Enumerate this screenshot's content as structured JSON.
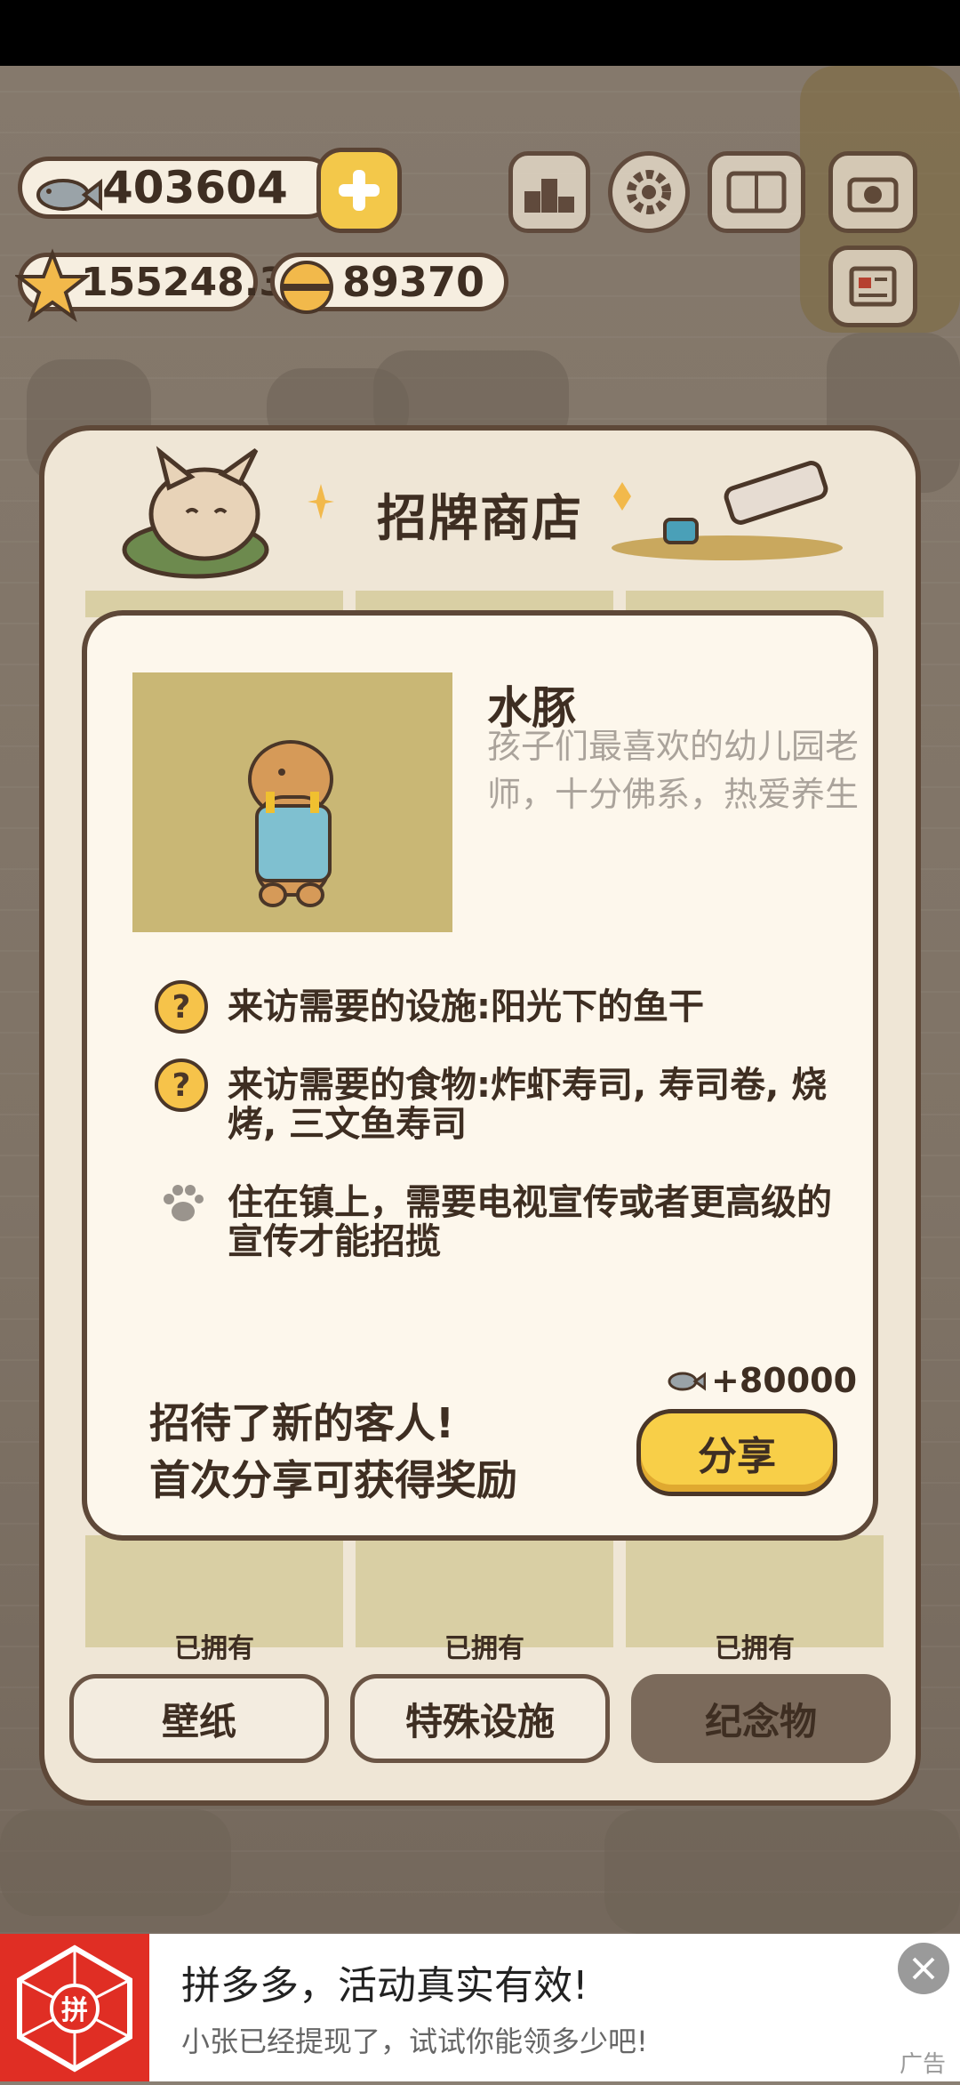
{
  "currencies": {
    "fish": "403604",
    "stars": "155248.3",
    "bells": "89370"
  },
  "store": {
    "title": "招牌商店",
    "owned_labels": [
      "已拥有",
      "已拥有",
      "已拥有"
    ],
    "tabs": [
      {
        "label": "壁纸",
        "active": false
      },
      {
        "label": "特殊设施",
        "active": false
      },
      {
        "label": "纪念物",
        "active": true
      }
    ]
  },
  "detail": {
    "name": "水豚",
    "description": "孩子们最喜欢的幼儿园老师，十分佛系，热爱养生",
    "requirements": [
      {
        "icon": "question-icon",
        "text": "来访需要的设施:阳光下的鱼干"
      },
      {
        "icon": "question-icon",
        "text": "来访需要的食物:炸虾寿司, 寿司卷, 烧烤, 三文鱼寿司"
      },
      {
        "icon": "paw-icon",
        "text": "住在镇上，需要电视宣传或者更高级的宣传才能招揽"
      }
    ],
    "reward": "+80000",
    "share_message_line1": "招待了新的客人!",
    "share_message_line2": "首次分享可获得奖励",
    "share_button": "分享"
  },
  "ad": {
    "title": "拼多多，活动真实有效!",
    "subtitle": "小张已经提现了，试试你能领多少吧!",
    "logo_text": "拼",
    "label": "广告"
  },
  "colors": {
    "accent_yellow": "#f8cf48",
    "outline_brown": "#5e4838",
    "ad_red": "#e02e24"
  }
}
